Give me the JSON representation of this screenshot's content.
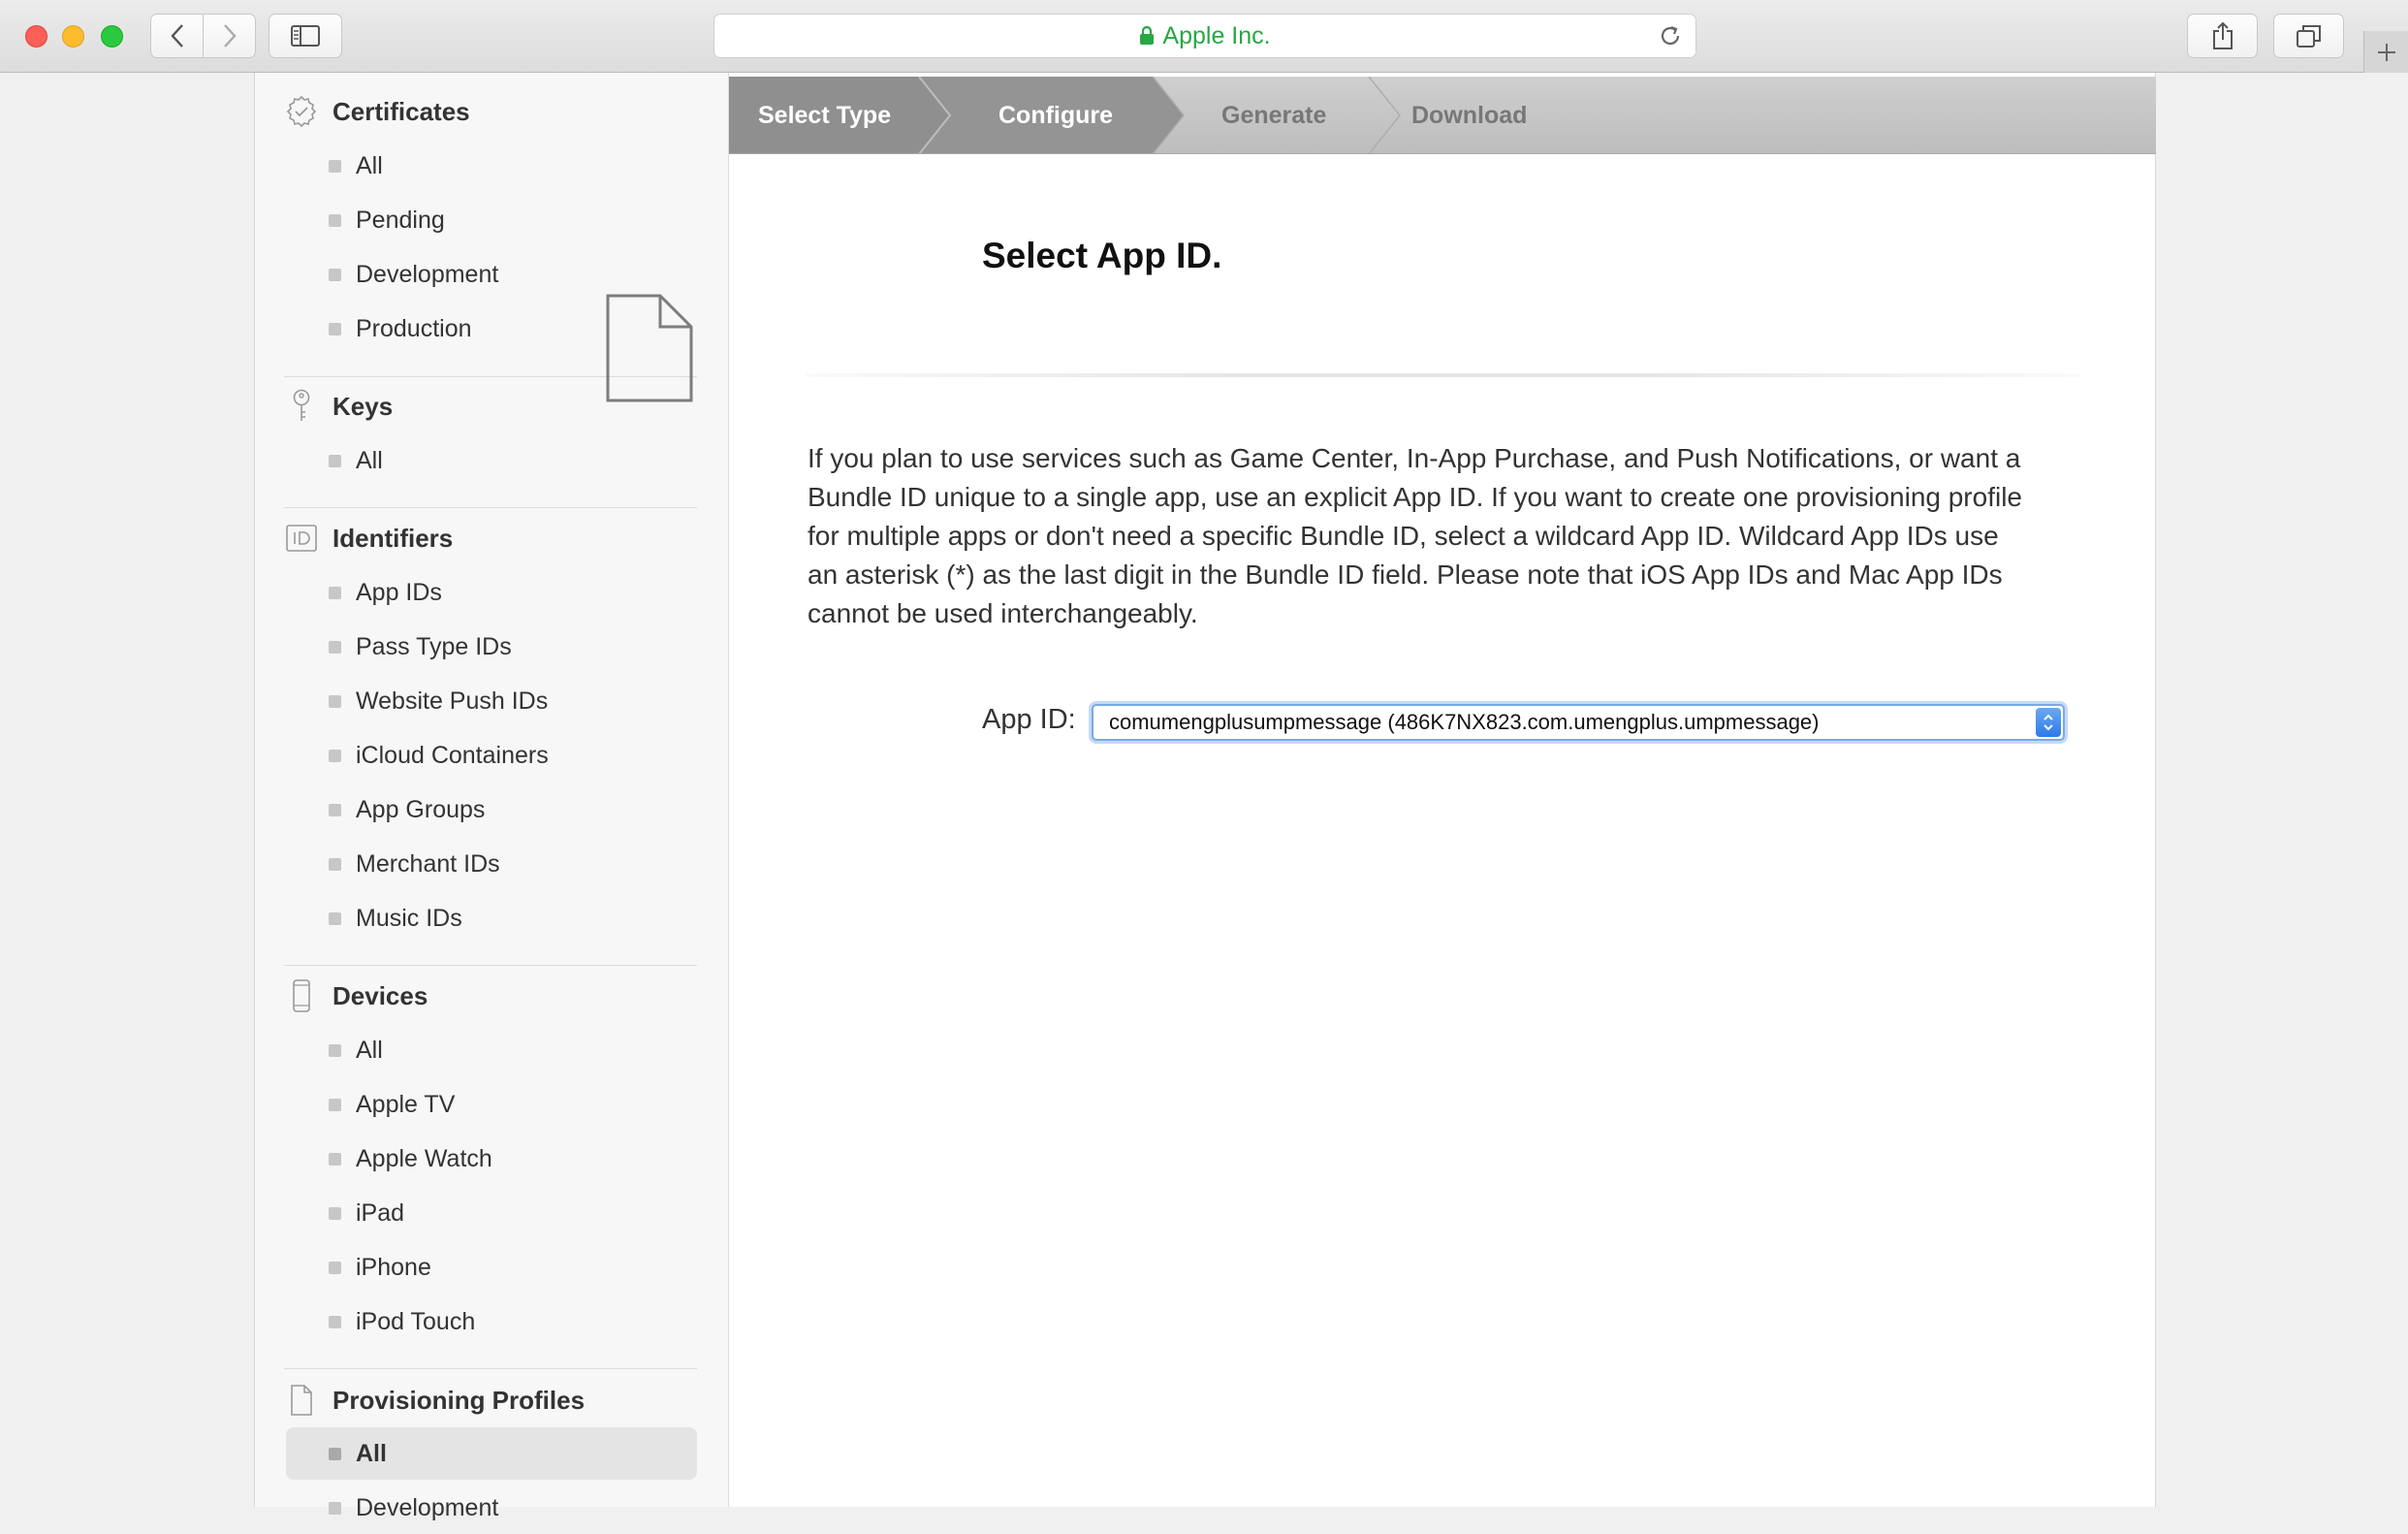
{
  "browser": {
    "address_text": "Apple Inc."
  },
  "sidebar": {
    "sections": [
      {
        "title": "Certificates",
        "icon": "certificate-badge-icon",
        "items": [
          "All",
          "Pending",
          "Development",
          "Production"
        ]
      },
      {
        "title": "Keys",
        "icon": "key-icon",
        "items": [
          "All"
        ]
      },
      {
        "title": "Identifiers",
        "icon": "id-icon",
        "items": [
          "App IDs",
          "Pass Type IDs",
          "Website Push IDs",
          "iCloud Containers",
          "App Groups",
          "Merchant IDs",
          "Music IDs"
        ]
      },
      {
        "title": "Devices",
        "icon": "device-icon",
        "items": [
          "All",
          "Apple TV",
          "Apple Watch",
          "iPad",
          "iPhone",
          "iPod Touch"
        ]
      },
      {
        "title": "Provisioning Profiles",
        "icon": "document-icon",
        "items": [
          "All",
          "Development"
        ]
      }
    ]
  },
  "steps": [
    "Select Type",
    "Configure",
    "Generate",
    "Download"
  ],
  "main": {
    "title": "Select App ID.",
    "description": "If you plan to use services such as Game Center, In-App Purchase, and Push Notifications, or want a Bundle ID unique to a single app, use an explicit App ID. If you want to create one provisioning profile for multiple apps or don't need a specific Bundle ID, select a wildcard App ID. Wildcard App IDs use an asterisk (*) as the last digit in the Bundle ID field. Please note that iOS App IDs and Mac App IDs cannot be used interchangeably.",
    "app_id_label": "App ID:",
    "app_id_value": "comumengplusumpmessage (486K7NX823.com.umengplus.umpmessage)"
  },
  "colors": {
    "secure_green": "#27a844",
    "step_active": "#8f8f8f",
    "step_inactive": "#c4c4c4"
  }
}
